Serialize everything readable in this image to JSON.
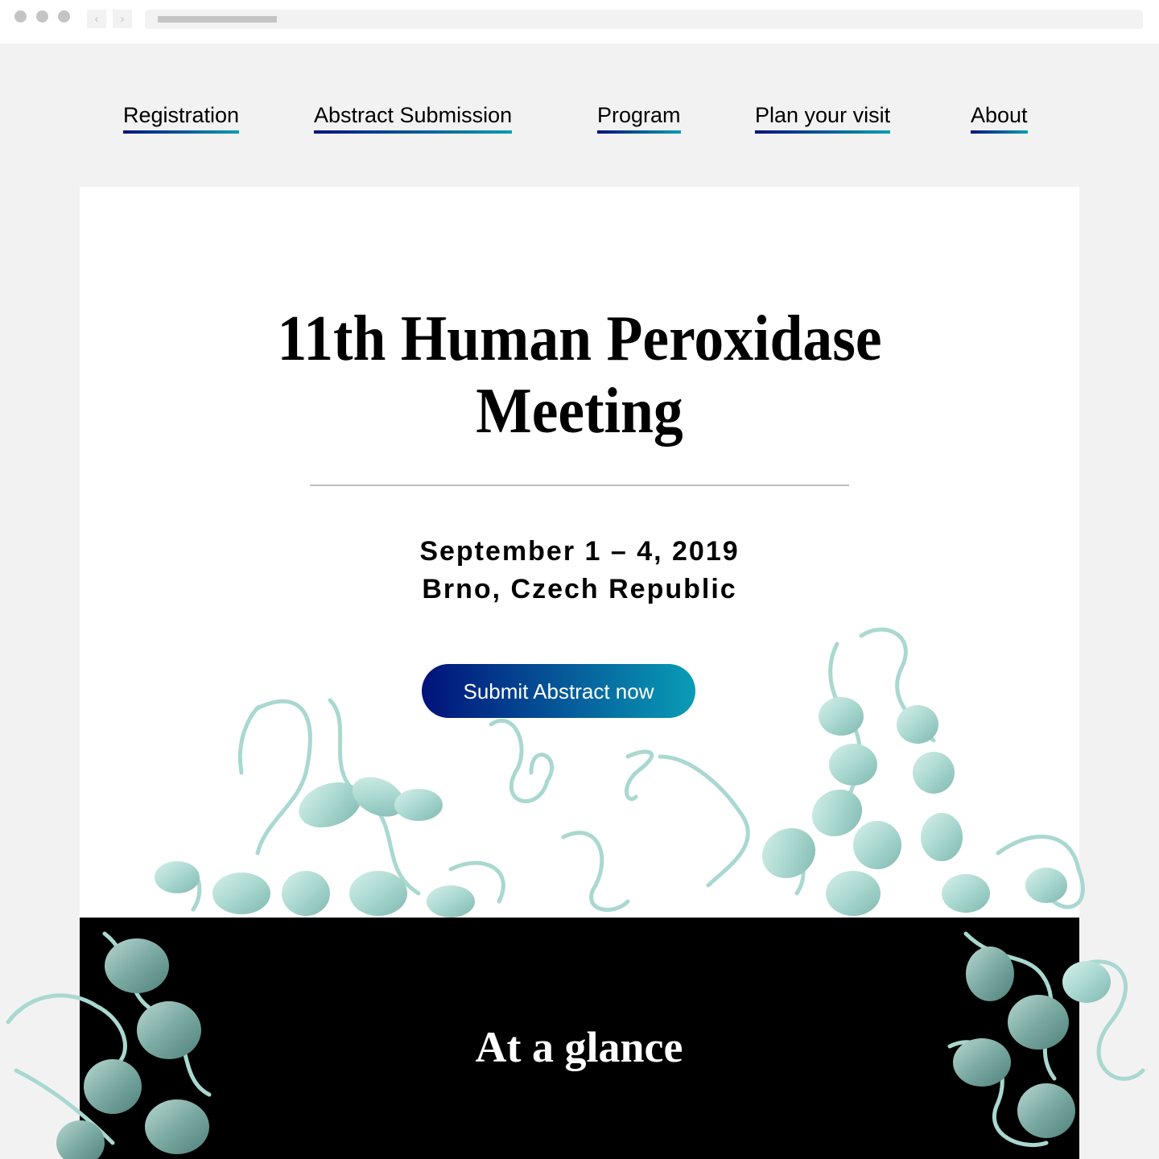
{
  "browser": {
    "back_icon": "‹",
    "forward_icon": "›"
  },
  "nav": {
    "items": [
      {
        "label": "Registration"
      },
      {
        "label": "Abstract Submission"
      },
      {
        "label": "Program"
      },
      {
        "label": "Plan your visit"
      },
      {
        "label": "About"
      }
    ]
  },
  "hero": {
    "title_line1": "11th Human Peroxidase",
    "title_line2": "Meeting",
    "dates": "September 1 – 4, 2019",
    "location": "Brno, Czech Republic",
    "cta_label": "Submit Abstract now",
    "illustration": "protein-ribbon-structure"
  },
  "section": {
    "heading": "At a glance"
  },
  "colors": {
    "accent_start": "#00127a",
    "accent_end": "#0a9cb6",
    "protein": "#a9d8d0",
    "page_bg": "#f2f2f2"
  }
}
